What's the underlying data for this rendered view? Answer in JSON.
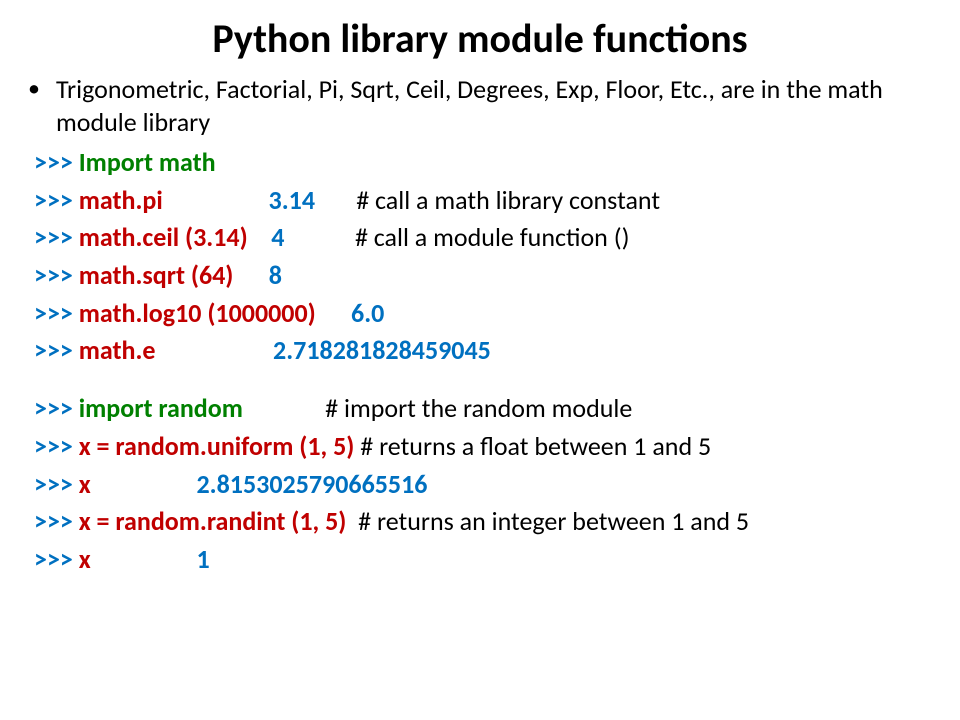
{
  "title": "Python library module functions",
  "intro": "Trigonometric, Factorial, Pi, Sqrt, Ceil, Degrees, Exp, Floor, Etc., are in the math module library",
  "p": ">>> ",
  "l1_cmd": "Import math",
  "l2_cmd": "math.pi",
  "l2_val": "3.14",
  "l2_cmt": "# call a math library constant",
  "l3_cmd": "math.ceil (3.14)",
  "l3_val": "4",
  "l3_cmt": "# call a module function ()",
  "l4_cmd": "math.sqrt (64)",
  "l4_val": "8",
  "l5_cmd": "math.log10 (1000000)",
  "l5_val": "6.0",
  "l6_cmd": "math.e",
  "l6_val": "2.718281828459045",
  "l7_cmd": "import random",
  "l7_cmt": "# import the random module",
  "l8_cmd": "x = random.uniform (1, 5)",
  "l8_cmt": " # returns a float between 1 and 5",
  "l9_cmd": "x",
  "l9_val": "2.8153025790665516",
  "l10_cmd": "x = random.randint (1, 5)",
  "l10_cmt": "  # returns an integer between 1 and 5",
  "l11_cmd": "x",
  "l11_val": "1"
}
